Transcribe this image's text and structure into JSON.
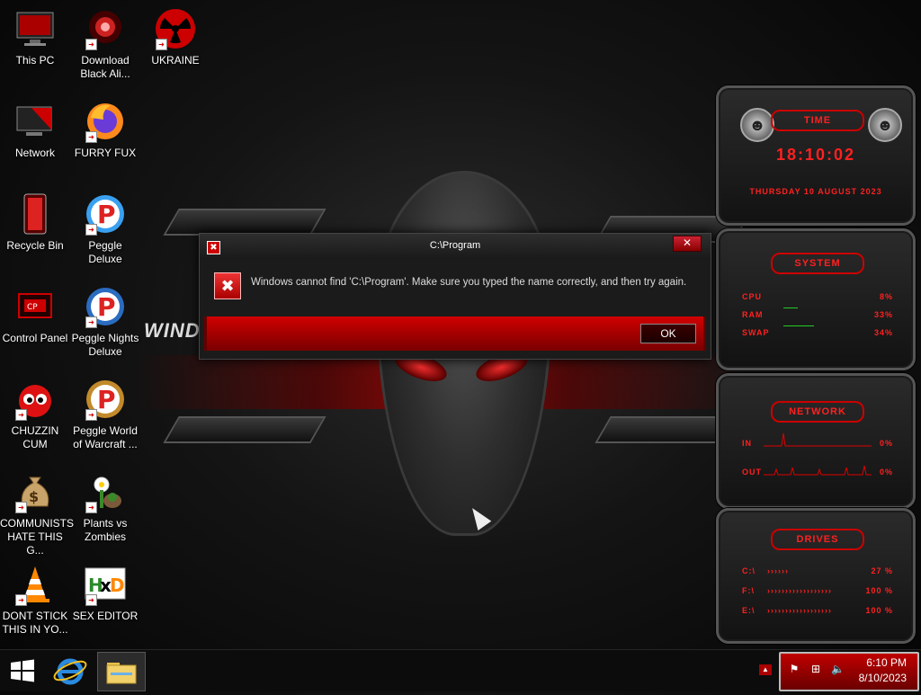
{
  "desktop_icons": [
    {
      "label": "This PC",
      "icon": "this-pc-icon"
    },
    {
      "label": "Download\nBlack Ali...",
      "icon": "alien-download-icon"
    },
    {
      "label": "UKRAINE",
      "icon": "radiation-icon"
    },
    {
      "label": "Network",
      "icon": "network-icon"
    },
    {
      "label": "FURRY FUX",
      "icon": "firefox-icon"
    },
    {
      "label": "Recycle Bin",
      "icon": "recycle-bin-icon"
    },
    {
      "label": "Peggle Deluxe",
      "icon": "peggle-icon"
    },
    {
      "label": "Control Panel",
      "icon": "control-panel-icon"
    },
    {
      "label": "Peggle Nights\nDeluxe",
      "icon": "peggle-nights-icon"
    },
    {
      "label": "CHUZZIN\nCUM",
      "icon": "chuzzle-icon"
    },
    {
      "label": "Peggle World\nof Warcraft ...",
      "icon": "peggle-wow-icon"
    },
    {
      "label": "COMMUNISTS\nHATE THIS G...",
      "icon": "money-bag-icon"
    },
    {
      "label": "Plants vs\nZombies",
      "icon": "plants-vs-zombies-icon"
    },
    {
      "label": "DONT STICK\nTHIS IN YO...",
      "icon": "vlc-cone-icon"
    },
    {
      "label": "SEX EDITOR",
      "icon": "hxd-icon"
    }
  ],
  "wallpaper_text": "WINDOW",
  "dialog": {
    "title": "C:\\Program",
    "message": "Windows cannot find 'C:\\Program'. Make sure you typed the name correctly, and then try again.",
    "ok_label": "OK",
    "close_label": "✕",
    "app_icon_glyph": "✖",
    "error_glyph": "✖"
  },
  "gadgets": {
    "time": {
      "title": "TIME",
      "time": "18:10:02",
      "date": "THURSDAY 10 AUGUST 2023"
    },
    "system": {
      "title": "SYSTEM",
      "rows": [
        {
          "label": "CPU",
          "value": "8%"
        },
        {
          "label": "RAM",
          "value": "33%"
        },
        {
          "label": "SWAP",
          "value": "34%"
        }
      ]
    },
    "network": {
      "title": "NETWORK",
      "rows": [
        {
          "label": "IN",
          "value": "0%"
        },
        {
          "label": "OUT",
          "value": "0%"
        }
      ]
    },
    "drives": {
      "title": "DRIVES",
      "rows": [
        {
          "label": "C:\\",
          "value": "27 %"
        },
        {
          "label": "F:\\",
          "value": "100 %"
        },
        {
          "label": "E:\\",
          "value": "100 %"
        }
      ]
    }
  },
  "taskbar": {
    "start_icon": "windows-logo-icon",
    "pinned": [
      {
        "name": "internet-explorer",
        "icon": "internet-explorer-icon"
      },
      {
        "name": "file-explorer",
        "icon": "folder-icon"
      }
    ],
    "clock_time": "6:10 PM",
    "clock_date": "8/10/2023"
  },
  "colors": {
    "accent": "#cc0000",
    "tray": "#b00000",
    "dialog_footer": "#c00000"
  }
}
